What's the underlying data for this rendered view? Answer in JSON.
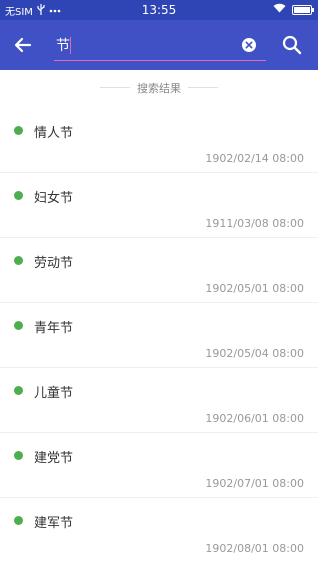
{
  "status_bar": {
    "carrier": "无SIM",
    "time": "13:55"
  },
  "search": {
    "value": "节"
  },
  "section_header": "搜索结果",
  "results": [
    {
      "title": "情人节",
      "date": "1902/02/14 08:00"
    },
    {
      "title": "妇女节",
      "date": "1911/03/08 08:00"
    },
    {
      "title": "劳动节",
      "date": "1902/05/01 08:00"
    },
    {
      "title": "青年节",
      "date": "1902/05/04 08:00"
    },
    {
      "title": "儿童节",
      "date": "1902/06/01 08:00"
    },
    {
      "title": "建党节",
      "date": "1902/07/01 08:00"
    },
    {
      "title": "建军节",
      "date": "1902/08/01 08:00"
    }
  ],
  "colors": {
    "appbar": "#3f51c5",
    "statusbar": "#2f45b6",
    "accent": "#e26ab0",
    "dot": "#4cae4f"
  },
  "icons": [
    "back-arrow-icon",
    "clear-icon",
    "search-icon",
    "usb-icon",
    "wifi-icon",
    "battery-icon"
  ]
}
